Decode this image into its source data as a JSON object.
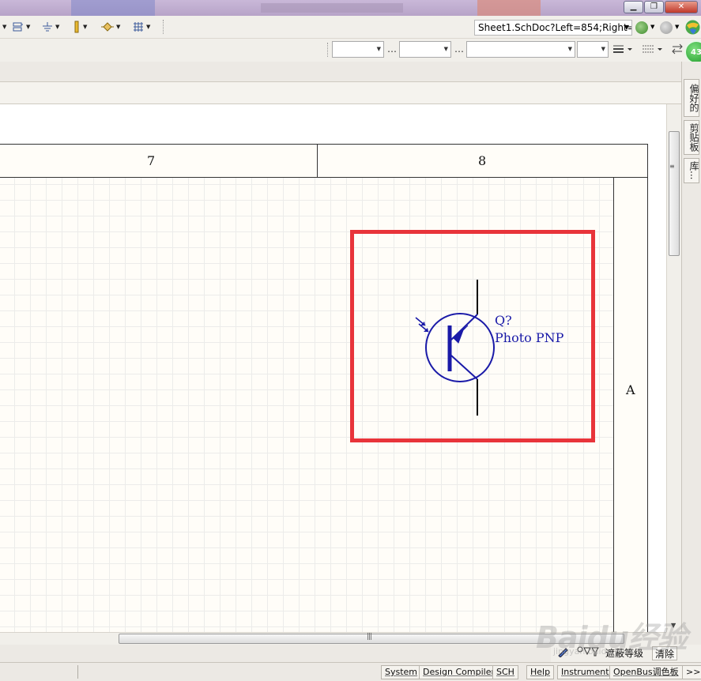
{
  "colors": {
    "highlight": "#e8343a",
    "component": "#1a1aa8",
    "sheet_border": "#333333"
  },
  "toolbar": {
    "icons": [
      "port-icon",
      "power-ground-icon",
      "pin-icon",
      "junction-icon",
      "grid-icon"
    ]
  },
  "address_bar": {
    "value": "Sheet1.SchDoc?Left=854;Right="
  },
  "sheet": {
    "zone_columns": [
      "7",
      "8"
    ],
    "zone_row": "A"
  },
  "component": {
    "designator": "Q?",
    "comment": "Photo PNP"
  },
  "side_panels": [
    "偏好的",
    "剪贴板",
    "库..."
  ],
  "mini_toolbar": {
    "filter_label": "遮蔽等级",
    "clear_label": "清除"
  },
  "status_bar": {
    "buttons": [
      "System",
      "Design Compiler",
      "SCH",
      "Help",
      "Instruments",
      "OpenBus调色板"
    ],
    "overflow": ">>"
  },
  "badge": "43",
  "watermark": {
    "main": "Baidu经验",
    "sub": "jingyan.baidu.com"
  }
}
